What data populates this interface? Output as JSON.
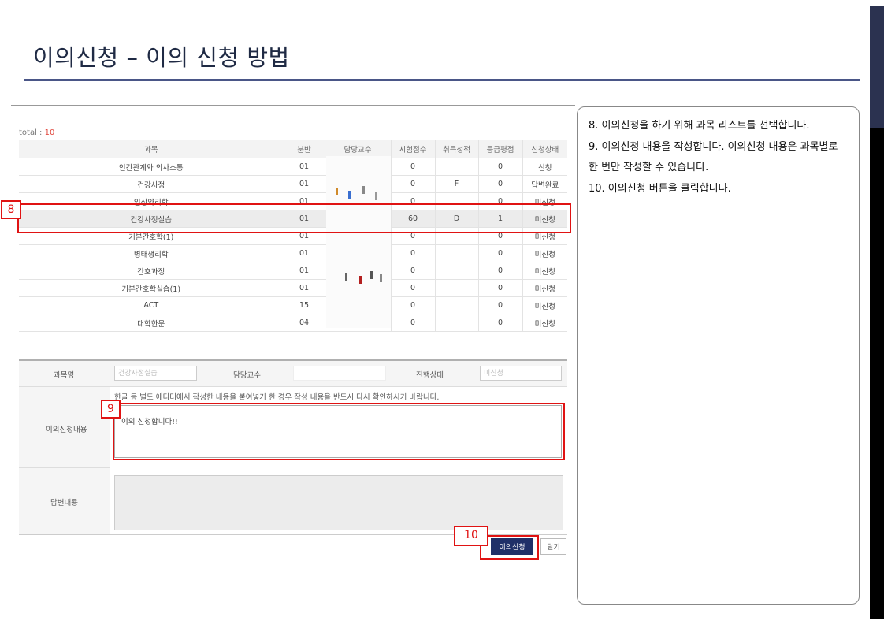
{
  "page": {
    "title": "이의신청 – 이의 신청 방법"
  },
  "total": {
    "label": "total :",
    "count": "10"
  },
  "table": {
    "headers": [
      "과목",
      "분반",
      "담당교수",
      "시험점수",
      "취득성적",
      "등급평점",
      "신청상태"
    ],
    "rows": [
      [
        "인간관계와 의사소통",
        "01",
        "",
        "0",
        "",
        "0",
        "신청"
      ],
      [
        "건강사정",
        "01",
        "",
        "0",
        "F",
        "0",
        "답변완료"
      ],
      [
        "임상약리학",
        "01",
        "",
        "0",
        "",
        "0",
        "미신청"
      ],
      [
        "건강사정실습",
        "01",
        "",
        "60",
        "D",
        "1",
        "미신청"
      ],
      [
        "기본간호학(1)",
        "01",
        "",
        "0",
        "",
        "0",
        "미신청"
      ],
      [
        "병태생리학",
        "01",
        "",
        "0",
        "",
        "0",
        "미신청"
      ],
      [
        "간호과정",
        "01",
        "",
        "0",
        "",
        "0",
        "미신청"
      ],
      [
        "기본간호학실습(1)",
        "01",
        "",
        "0",
        "",
        "0",
        "미신청"
      ],
      [
        "ACT",
        "15",
        "",
        "0",
        "",
        "0",
        "미신청"
      ],
      [
        "대학한문",
        "04",
        "",
        "0",
        "",
        "0",
        "미신청"
      ]
    ]
  },
  "form": {
    "course_label": "과목명",
    "course_value": "건강사정실습",
    "professor_label": "담당교수",
    "status_label": "진행상태",
    "status_value": "미신청",
    "warning": "한글 등 별도 에디터에서 작성한 내용을 붙여넣기 한 경우 작성 내용을 반드시 다시 확인하시기 바랍니다.",
    "content_label": "이의신청내용",
    "content_value": "이의 신청합니다!!",
    "answer_label": "답변내용"
  },
  "buttons": {
    "apply": "이의신청",
    "close": "닫기"
  },
  "callouts": [
    "8",
    "9",
    "10"
  ],
  "instructions": [
    "8. 이의신청을 하기 위해 과목 리스트를 선택합니다.",
    "9. 이의신청 내용을 작성합니다. 이의신청 내용은 과목별로 한 번만 작성할 수 있습니다.",
    "10. 이의신청 버튼을 클릭합니다."
  ],
  "colors": {
    "accent": "#e01313",
    "title_rule": "#4a5687",
    "apply_button": "#1f3068",
    "total_count": "#e0463c"
  }
}
